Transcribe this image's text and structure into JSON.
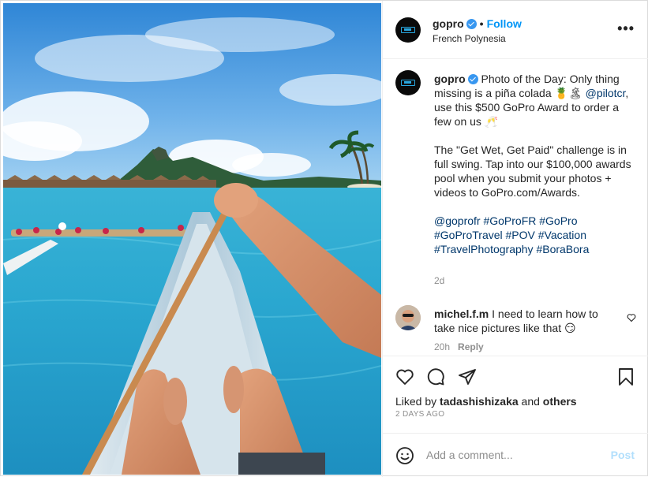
{
  "header": {
    "username": "gopro",
    "follow_label": "Follow",
    "location": "French Polynesia",
    "more_icon": "more-dots-icon"
  },
  "caption": {
    "username": "gopro",
    "line1": "Photo of the Day: Only thing missing is a piña colada 🍍🏝",
    "mention": "@pilotcr",
    "line1b": ", use this $500 GoPro Award to order a few on us 🥂",
    "para2": "The \"Get Wet, Get Paid\" challenge is in full swing. Tap into our $100,000 awards pool when you submit your photos + videos to GoPro.com/Awards.",
    "hashtags": "@goprofr #GoProFR #GoPro #GoProTravel #POV #Vacation #TravelPhotography #BoraBora",
    "time": "2d"
  },
  "comment": {
    "username": "michel.f.m",
    "text": "I need to learn how to take nice pictures like that 😏",
    "time": "20h",
    "reply_label": "Reply"
  },
  "actions": {
    "liked_by_prefix": "Liked by",
    "liked_by_user": "tadashishizaka",
    "and": "and",
    "others": "others",
    "date": "2 DAYS AGO"
  },
  "add_comment": {
    "placeholder": "Add a comment...",
    "post_label": "Post"
  },
  "colors": {
    "accent": "#0095f6",
    "link": "#00376b",
    "muted": "#8e8e8e",
    "post_disabled": "#b2dffc",
    "verified": "#3897f0"
  }
}
